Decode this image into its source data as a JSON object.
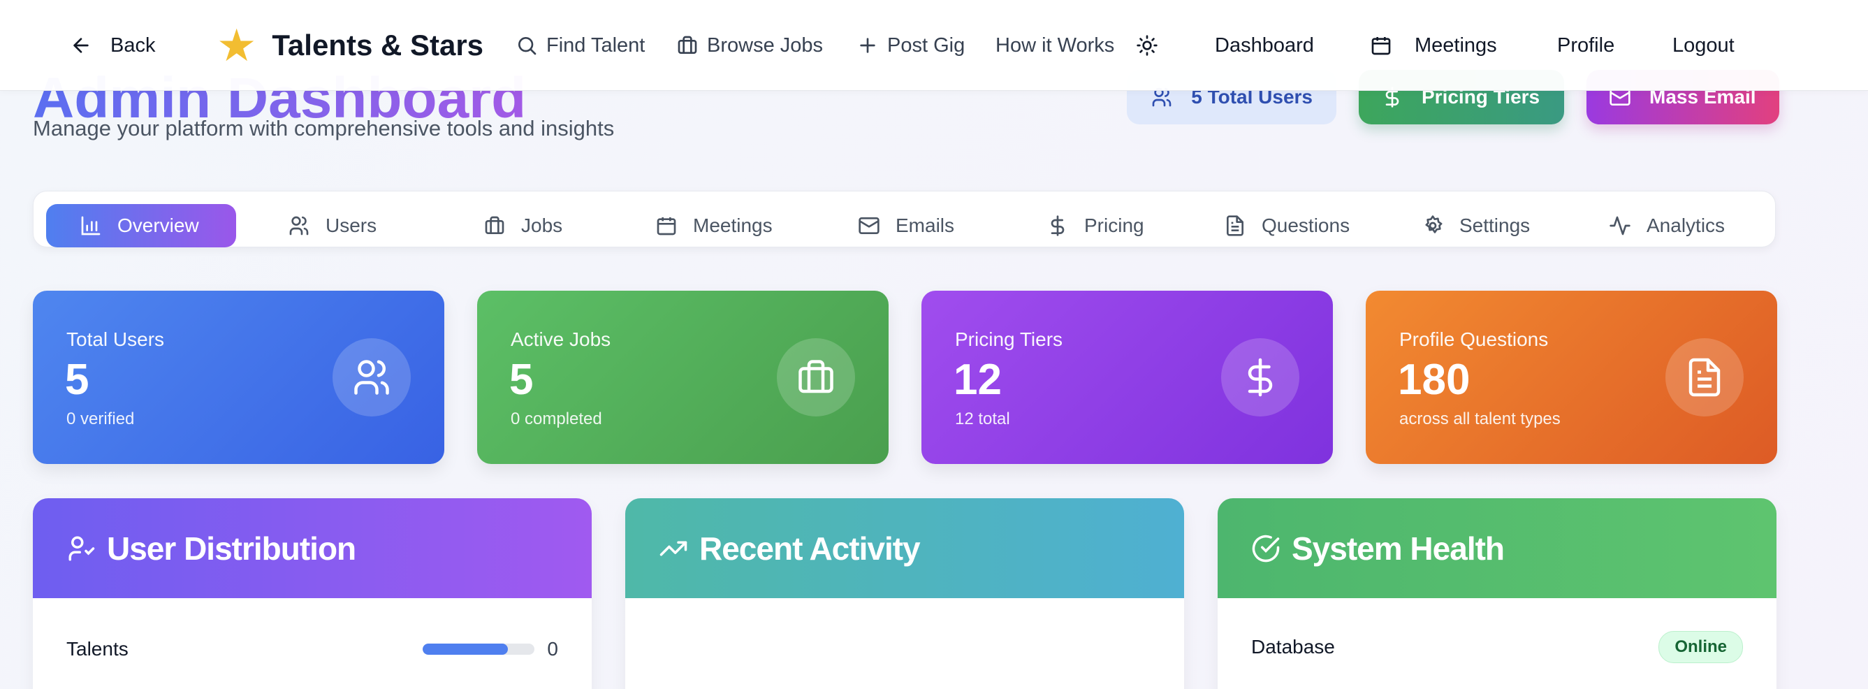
{
  "nav": {
    "back": "Back",
    "brand": "Talents & Stars",
    "find_talent": "Find Talent",
    "browse_jobs": "Browse Jobs",
    "post_gig": "Post Gig",
    "how_it_works": "How it Works",
    "dashboard": "Dashboard",
    "meetings": "Meetings",
    "profile": "Profile",
    "logout": "Logout"
  },
  "header": {
    "title": "Admin Dashboard",
    "subtitle": "Manage your platform with comprehensive tools and insights",
    "total_users": "5 Total Users",
    "pricing_tiers": "Pricing Tiers",
    "mass_email": "Mass Email"
  },
  "tabs": [
    {
      "label": "Overview",
      "active": true
    },
    {
      "label": "Users"
    },
    {
      "label": "Jobs"
    },
    {
      "label": "Meetings"
    },
    {
      "label": "Emails"
    },
    {
      "label": "Pricing"
    },
    {
      "label": "Questions"
    },
    {
      "label": "Settings"
    },
    {
      "label": "Analytics"
    }
  ],
  "stats": [
    {
      "label": "Total Users",
      "value": "5",
      "sub": "0 verified",
      "color": "#3f6fe8"
    },
    {
      "label": "Active Jobs",
      "value": "5",
      "sub": "0 completed",
      "color": "#53ae58"
    },
    {
      "label": "Pricing Tiers",
      "value": "12",
      "sub": "12 total",
      "color": "#8d3fe6"
    },
    {
      "label": "Profile Questions",
      "value": "180",
      "sub": "across all talent types",
      "color": "#e8712b"
    }
  ],
  "panels": {
    "distribution": {
      "title": "User Distribution",
      "rows": [
        {
          "label": "Talents",
          "count": "0",
          "fill": 0.76
        }
      ]
    },
    "activity": {
      "title": "Recent Activity"
    },
    "health": {
      "title": "System Health",
      "rows": [
        {
          "label": "Database",
          "status": "Online"
        }
      ]
    }
  }
}
